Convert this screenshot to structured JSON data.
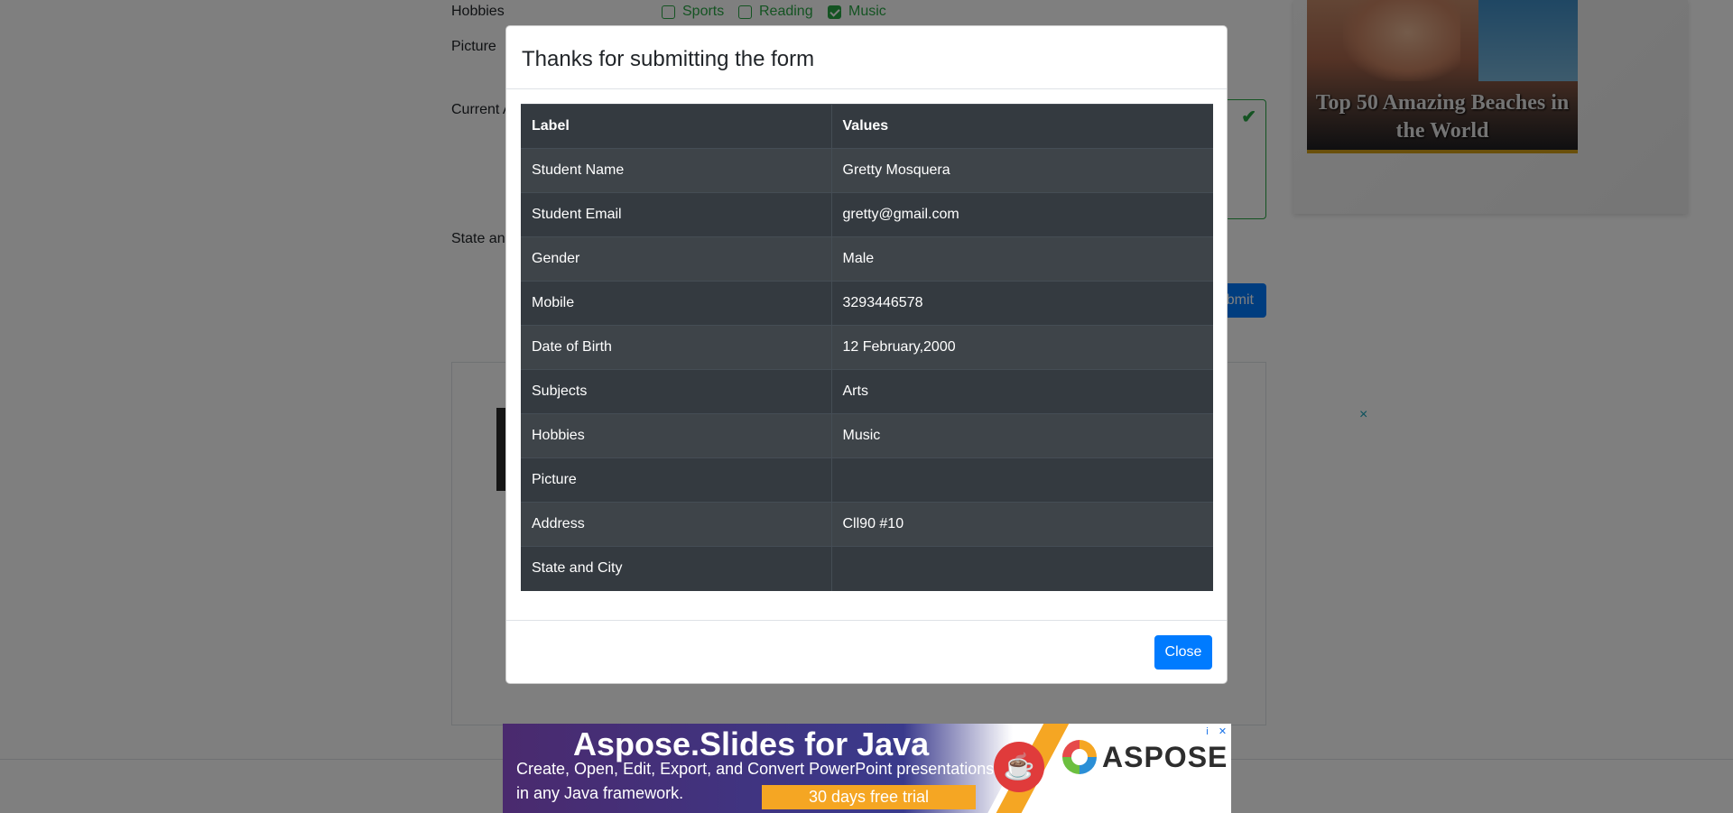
{
  "background_form": {
    "hobbies_label": "Hobbies",
    "picture_label": "Picture",
    "address_label": "Current A",
    "state_label": "State and",
    "hobbies": [
      {
        "label": "Sports",
        "checked": false
      },
      {
        "label": "Reading",
        "checked": false
      },
      {
        "label": "Music",
        "checked": true
      }
    ],
    "valid_icon": "check-icon",
    "submit_label": "bmit",
    "ad_close": "×"
  },
  "side_ad": {
    "title": "Top 50 Amazing Beaches in the World"
  },
  "modal": {
    "title": "Thanks for submitting the form",
    "table": {
      "headers": [
        "Label",
        "Values"
      ],
      "rows": [
        {
          "label": "Student Name",
          "value": "Gretty Mosquera"
        },
        {
          "label": "Student Email",
          "value": "gretty@gmail.com"
        },
        {
          "label": "Gender",
          "value": "Male"
        },
        {
          "label": "Mobile",
          "value": "3293446578"
        },
        {
          "label": "Date of Birth",
          "value": "12 February,2000"
        },
        {
          "label": "Subjects",
          "value": "Arts"
        },
        {
          "label": "Hobbies",
          "value": "Music"
        },
        {
          "label": "Picture",
          "value": ""
        },
        {
          "label": "Address",
          "value": "Cll90 #10"
        },
        {
          "label": "State and City",
          "value": ""
        }
      ]
    },
    "close_label": "Close"
  },
  "banner_ad": {
    "title": "Aspose.Slides for Java",
    "line1": "Create, Open, Edit, Export, and Convert PowerPoint presentations",
    "line2": "in any Java framework.",
    "cta": "30 days free trial",
    "brand": "ASPOSE",
    "info_icon": "i",
    "close_icon": "✕"
  },
  "colors": {
    "primary": "#007bff",
    "success": "#28a745",
    "table_dark": "#343a40",
    "backdrop": "rgba(0,0,0,0.5)"
  }
}
